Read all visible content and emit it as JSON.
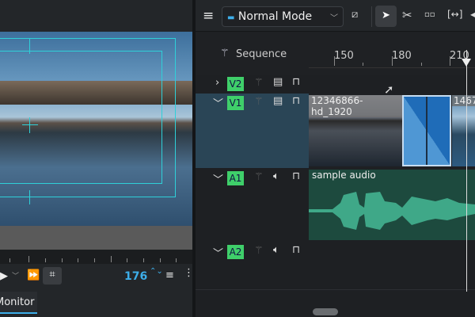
{
  "monitor": {
    "timecode": "176",
    "tab_label": "Monitor",
    "buttons": {
      "play": "▶",
      "dropdown": "﹀",
      "forward": "⏩",
      "crop": "⌗",
      "menu": "≡",
      "spin": "⌃⌄",
      "more": "⋮"
    }
  },
  "toolbar": {
    "menu_icon": "≡",
    "mode_label": "Normal Mode",
    "mode_chevron": "﹀",
    "icons": [
      "hamburger-icon",
      "magnet-off-icon",
      "select-arrow-icon",
      "razor-icon",
      "spacer-icon",
      "ripple-icon"
    ]
  },
  "timeline": {
    "sequence_label": "Sequence",
    "ruler_ticks": [
      "150",
      "180",
      "210"
    ],
    "tracks": [
      {
        "name": "V2",
        "type": "video",
        "expanded": false
      },
      {
        "name": "V1",
        "type": "video",
        "expanded": true
      },
      {
        "name": "A1",
        "type": "audio",
        "expanded": true
      },
      {
        "name": "A2",
        "type": "audio",
        "expanded": true
      }
    ],
    "clips": {
      "v1_clip1": "12346866-hd_1920",
      "v1_clip2": "1467",
      "a1_clip": "sample audio"
    },
    "playhead_frame": 213
  },
  "colors": {
    "accent": "#3daee9",
    "track_label": "#3fcf6a",
    "audio_clip": "#1d4a3e",
    "waveform": "#3fa888",
    "transition": "#2f7fc8",
    "selected_track": "#2a4556"
  }
}
